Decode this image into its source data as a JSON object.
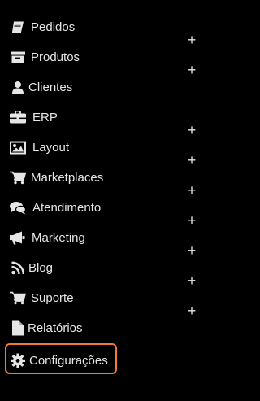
{
  "menu": {
    "items": [
      {
        "label": "Pedidos",
        "icon": "book-icon",
        "expandable": true,
        "expand_symbol": "+"
      },
      {
        "label": "Produtos",
        "icon": "archive-box-icon",
        "expandable": true,
        "expand_symbol": "+"
      },
      {
        "label": "Clientes",
        "icon": "user-icon",
        "expandable": false
      },
      {
        "label": "ERP",
        "icon": "briefcase-icon",
        "expandable": true,
        "expand_symbol": "+"
      },
      {
        "label": "Layout",
        "icon": "image-icon",
        "expandable": true,
        "expand_symbol": "+"
      },
      {
        "label": "Marketplaces",
        "icon": "shopping-cart-icon",
        "expandable": true,
        "expand_symbol": "+"
      },
      {
        "label": "Atendimento",
        "icon": "chat-bubbles-icon",
        "expandable": true,
        "expand_symbol": "+"
      },
      {
        "label": "Marketing",
        "icon": "megaphone-icon",
        "expandable": true,
        "expand_symbol": "+"
      },
      {
        "label": "Blog",
        "icon": "rss-icon",
        "expandable": true,
        "expand_symbol": "+"
      },
      {
        "label": "Suporte",
        "icon": "shopping-cart-icon",
        "expandable": true,
        "expand_symbol": "+"
      },
      {
        "label": "Relatórios",
        "icon": "file-icon",
        "expandable": false
      },
      {
        "label": "Configurações",
        "icon": "gear-icon",
        "expandable": false,
        "highlighted": true
      }
    ]
  },
  "colors": {
    "background": "#000000",
    "text": "#e6e6e6",
    "highlight_border": "#f07a36"
  }
}
